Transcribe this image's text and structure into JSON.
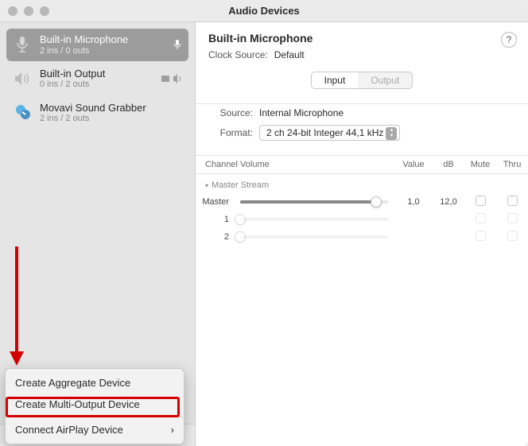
{
  "title": "Audio Devices",
  "sidebar": {
    "devices": [
      {
        "name": "Built-in Microphone",
        "sub": "2 ins / 0 outs",
        "selected": true,
        "icon": "mic"
      },
      {
        "name": "Built-in Output",
        "sub": "0 ins / 2 outs",
        "selected": false,
        "icon": "speaker"
      },
      {
        "name": "Movavi Sound Grabber",
        "sub": "2 ins / 2 outs",
        "selected": false,
        "icon": "app"
      }
    ]
  },
  "footer_icons": {
    "plus": "+",
    "minus": "−",
    "gear": "⚙",
    "chevron": "⌄"
  },
  "main": {
    "title": "Built-in Microphone",
    "clock_label": "Clock Source:",
    "clock_value": "Default",
    "help": "?",
    "tabs": {
      "input": "Input",
      "output": "Output",
      "active": "input"
    },
    "source_label": "Source:",
    "source_value": "Internal Microphone",
    "format_label": "Format:",
    "format_value": "2 ch 24-bit Integer 44,1 kHz",
    "columns": {
      "vol": "Channel Volume",
      "val": "Value",
      "db": "dB",
      "mute": "Mute",
      "thru": "Thru"
    },
    "stream_label": "Master Stream",
    "channels": [
      {
        "name": "Master",
        "value": "1,0",
        "db": "12,0",
        "fill": 92,
        "enabled": true
      },
      {
        "name": "1",
        "value": "",
        "db": "",
        "fill": 0,
        "enabled": false
      },
      {
        "name": "2",
        "value": "",
        "db": "",
        "fill": 0,
        "enabled": false
      }
    ]
  },
  "menu": {
    "item1": "Create Aggregate Device",
    "item2": "Create Multi-Output Device",
    "item3": "Connect AirPlay Device",
    "chevron": "›"
  }
}
